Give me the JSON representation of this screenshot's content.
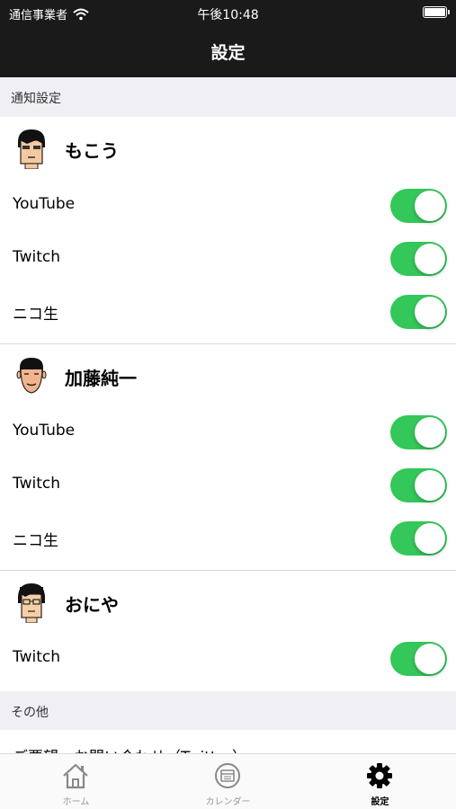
{
  "status_bar": {
    "carrier": "通信事業者",
    "time": "午後10:48"
  },
  "nav": {
    "title": "設定"
  },
  "sections": {
    "notifications": "通知設定",
    "other": "その他"
  },
  "people": [
    {
      "name": "もこう",
      "rows": [
        {
          "label": "YouTube",
          "on": true
        },
        {
          "label": "Twitch",
          "on": true
        },
        {
          "label": "ニコ生",
          "on": true
        }
      ]
    },
    {
      "name": "加藤純一",
      "rows": [
        {
          "label": "YouTube",
          "on": true
        },
        {
          "label": "Twitch",
          "on": true
        },
        {
          "label": "ニコ生",
          "on": true
        }
      ]
    },
    {
      "name": "おにや",
      "rows": [
        {
          "label": "Twitch",
          "on": true
        }
      ]
    }
  ],
  "other_items": [
    "ご要望・お問い合わせ（Twitter）"
  ],
  "tabs": [
    {
      "label": "ホーム",
      "icon": "home-icon",
      "active": false
    },
    {
      "label": "カレンダー",
      "icon": "calendar-icon",
      "active": false
    },
    {
      "label": "設定",
      "icon": "gear-icon",
      "active": true
    }
  ],
  "colors": {
    "toggle_on": "#34c759",
    "nav_bg": "#1a1a1a"
  }
}
